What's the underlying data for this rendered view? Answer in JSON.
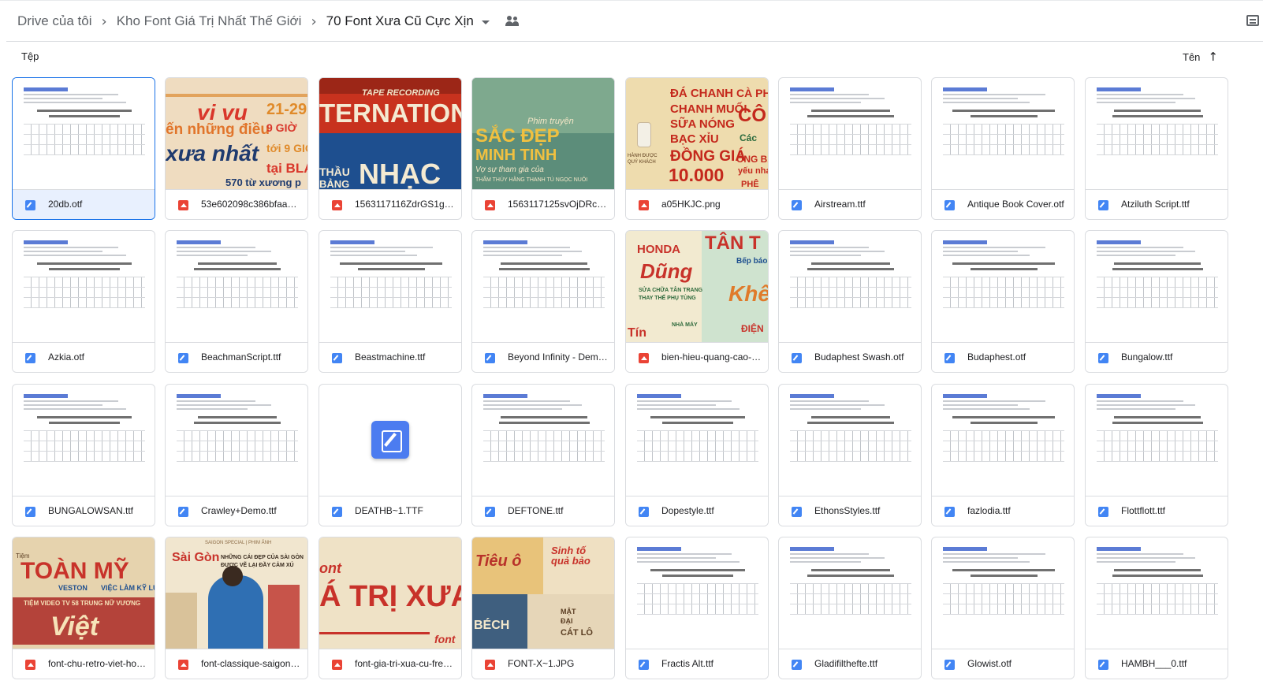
{
  "breadcrumb": {
    "items": [
      "Drive của tôi",
      "Kho Font Giá Trị Nhất Thế Giới",
      "70 Font Xưa Cũ Cực Xịn"
    ]
  },
  "list_header": {
    "files_label": "Tệp",
    "sort_label": "Tên"
  },
  "icons": {
    "doc": "docs-icon",
    "image": "image-icon",
    "shared": "shared-people-icon",
    "view": "list-view-icon",
    "sort": "arrow-up-icon"
  },
  "colors": {
    "accent": "#1a73e8",
    "doc_icon": "#4285f4",
    "image_icon": "#ea4335",
    "selected_bg": "#e8f0fe"
  },
  "files": [
    {
      "name": "20db.otf",
      "type": "doc",
      "preview": "doc"
    },
    {
      "name": "53e602098c386bfaae72...",
      "type": "image",
      "preview": "vivu"
    },
    {
      "name": "1563117116ZdrGS1giU7...",
      "type": "image",
      "preview": "ternation"
    },
    {
      "name": "1563117125svOjDRcHt...",
      "type": "image",
      "preview": "sacdep"
    },
    {
      "name": "a05HKJC.png",
      "type": "image",
      "preview": "dachanh"
    },
    {
      "name": "Airstream.ttf",
      "type": "doc",
      "preview": "doc"
    },
    {
      "name": "Antique Book Cover.otf",
      "type": "doc",
      "preview": "doc"
    },
    {
      "name": "Atziluth Script.ttf",
      "type": "doc",
      "preview": "doc"
    },
    {
      "name": "Azkia.otf",
      "type": "doc",
      "preview": "doc"
    },
    {
      "name": "BeachmanScript.ttf",
      "type": "doc",
      "preview": "doc"
    },
    {
      "name": "Beastmachine.ttf",
      "type": "doc",
      "preview": "doc"
    },
    {
      "name": "Beyond Infinity - Demo_0...",
      "type": "doc",
      "preview": "doc"
    },
    {
      "name": "bien-hieu-quang-cao-sai...",
      "type": "image",
      "preview": "honda"
    },
    {
      "name": "Budaphest Swash.otf",
      "type": "doc",
      "preview": "doc"
    },
    {
      "name": "Budaphest.otf",
      "type": "doc",
      "preview": "doc"
    },
    {
      "name": "Bungalow.ttf",
      "type": "doc",
      "preview": "doc"
    },
    {
      "name": "BUNGALOWSAN.ttf",
      "type": "doc",
      "preview": "doc"
    },
    {
      "name": "Crawley+Demo.ttf",
      "type": "doc",
      "preview": "doc"
    },
    {
      "name": "DEATHB~1.TTF",
      "type": "doc",
      "preview": "docicon"
    },
    {
      "name": "DEFTONE.ttf",
      "type": "doc",
      "preview": "doc"
    },
    {
      "name": "Dopestyle.ttf",
      "type": "doc",
      "preview": "doc"
    },
    {
      "name": "EthonsStyles.ttf",
      "type": "doc",
      "preview": "doc"
    },
    {
      "name": "fazlodia.ttf",
      "type": "doc",
      "preview": "doc"
    },
    {
      "name": "Flottflott.ttf",
      "type": "doc",
      "preview": "doc"
    },
    {
      "name": "font-chu-retro-viet-hoa-1...",
      "type": "image",
      "preview": "toanmy"
    },
    {
      "name": "font-classique-saigon-fu...",
      "type": "image",
      "preview": "saigon"
    },
    {
      "name": "font-gia-tri-xua-cu-free-1...",
      "type": "image",
      "preview": "tri"
    },
    {
      "name": "FONT-X~1.JPG",
      "type": "image",
      "preview": "collage"
    },
    {
      "name": "Fractis Alt.ttf",
      "type": "doc",
      "preview": "doc"
    },
    {
      "name": "Gladifilthefte.ttf",
      "type": "doc",
      "preview": "doc"
    },
    {
      "name": "Glowist.otf",
      "type": "doc",
      "preview": "doc"
    },
    {
      "name": "HAMBH___0.ttf",
      "type": "doc",
      "preview": "doc"
    }
  ],
  "previews": {
    "doc_heading": "Font information",
    "vivu": {
      "a": "vi vu",
      "b": "ến những điều",
      "c": "xưa nhất",
      "d": "21-29",
      "e": "9 GIỜ",
      "f": "tới 9 GIỜ",
      "g": "tại BLA",
      "h": "570 từ xương p"
    },
    "ternation": {
      "a": "TAPE RECORDING",
      "b": "TERNATION",
      "c": "THẦU",
      "d": "BẢNG",
      "e": "NHẠC"
    },
    "sacdep": {
      "a": "Phim truyện",
      "b": "SẮC ĐẸP",
      "c": "MINH TINH",
      "d": "Vợ sự tham gia của",
      "e": "THẨM THÚY HẰNG   THANH TÚ   NGỌC NUÔI"
    },
    "dachanh": {
      "a": "ĐÁ CHANH",
      "b": "CHANH MUỐI",
      "c": "SỮA NÓNG",
      "d": "BẠC XỈU",
      "e": "ĐỒNG GIÁ",
      "f": "10.000",
      "g": "CÀ PH",
      "h": "CÔ",
      "i": "Các",
      "j": "ỐNG BẢ",
      "k": "yếu nha",
      "l": "HÀNH ĐƯỢC QUÝ KHÁCH",
      "m": "PHÊ"
    },
    "honda": {
      "a": "HONDA",
      "b": "Dũng",
      "c": "SỬA CHỮA TÂN TRANG",
      "d": "THAY THẾ PHỤ TÙNG",
      "e": "TÂN T",
      "f": "Bếp báo",
      "g": "Khê",
      "h": "NHÀ MÁY",
      "i": "ĐIỆN",
      "j": "Tín"
    },
    "toanmy": {
      "a": "TOÀN MỸ",
      "b": "VESTON",
      "c": "VIỆC LÀM KỸ LƯ",
      "d": "TIỆM VIDEO TV 58 TRUNG NỮ VƯƠNG",
      "e": "Việt",
      "f": "Tiệm"
    },
    "saigon": {
      "a": "Sài Gòn",
      "b": "NHỮNG CÁI ĐẸP CỦA SÀI GÒN",
      "c": "ĐƯỢC VẼ LẠI ĐẦY CẢM XÚ",
      "d": "SAIGON SPECIAL | PHIM ẢNH"
    },
    "tri": {
      "a": "ont",
      "b": "Á TRỊ XƯA C",
      "c": "TRI",
      "d": "font"
    },
    "collage": {
      "a": "Tiêu ô",
      "b": "Sinh tố quả bảo",
      "c": "BÉCH",
      "d": "CÁT LÔ",
      "e": "MẬT",
      "f": "ĐẠI"
    }
  }
}
